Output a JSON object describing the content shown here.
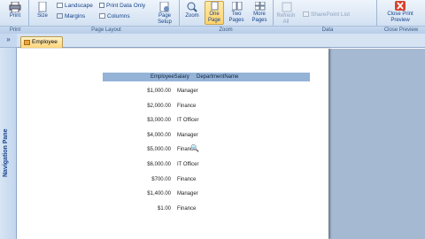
{
  "ribbon": {
    "print_group": {
      "print_label": "Print",
      "group_label": "Print"
    },
    "page_layout": {
      "size_label": "Size",
      "landscape_label": "Landscape",
      "margins_label": "Margins",
      "print_data_only_label": "Print Data Only",
      "columns_label": "Columns",
      "page_setup_label": "Page Setup",
      "group_label": "Page Layout"
    },
    "zoom_group": {
      "zoom_label": "Zoom",
      "one_page_label": "One Page",
      "two_pages_label": "Two Pages",
      "more_pages_label": "More Pages",
      "group_label": "Zoom"
    },
    "data_group": {
      "refresh_all_label": "Refresh All",
      "sharepoint_list_label": "SharePoint List",
      "group_label": "Data"
    },
    "close_group": {
      "close_print_preview_label": "Close Print Preview",
      "group_label": "Close Preview"
    }
  },
  "nav_pane": {
    "title": "Navigation Pane",
    "toggle": "»"
  },
  "document_tab": {
    "label": "Employee"
  },
  "report": {
    "columns": [
      "EmployeeSalary",
      "DepartmentName"
    ],
    "rows": [
      {
        "salary": "$1,000.00",
        "department": "Manager"
      },
      {
        "salary": "$2,000.00",
        "department": "Finance"
      },
      {
        "salary": "$3,000.00",
        "department": "IT Officer"
      },
      {
        "salary": "$4,000.00",
        "department": "Manager"
      },
      {
        "salary": "$5,000.00",
        "department": "Finance"
      },
      {
        "salary": "$6,000.00",
        "department": "IT Officer"
      },
      {
        "salary": "$700.00",
        "department": "Finance"
      },
      {
        "salary": "$1,400.00",
        "department": "Manager"
      },
      {
        "salary": "$1.00",
        "department": "Finance"
      }
    ]
  },
  "colors": {
    "header_fill": "#95b3d7",
    "active_button": "#ffd36b",
    "workspace": "#a5b9d3"
  },
  "icons": [
    "printer-icon",
    "page-size-icon",
    "landscape-icon",
    "margins-icon",
    "columns-icon",
    "page-setup-icon",
    "zoom-icon",
    "one-page-icon",
    "two-pages-icon",
    "more-pages-icon",
    "refresh-icon",
    "close-icon",
    "magnifier-cursor-icon"
  ]
}
